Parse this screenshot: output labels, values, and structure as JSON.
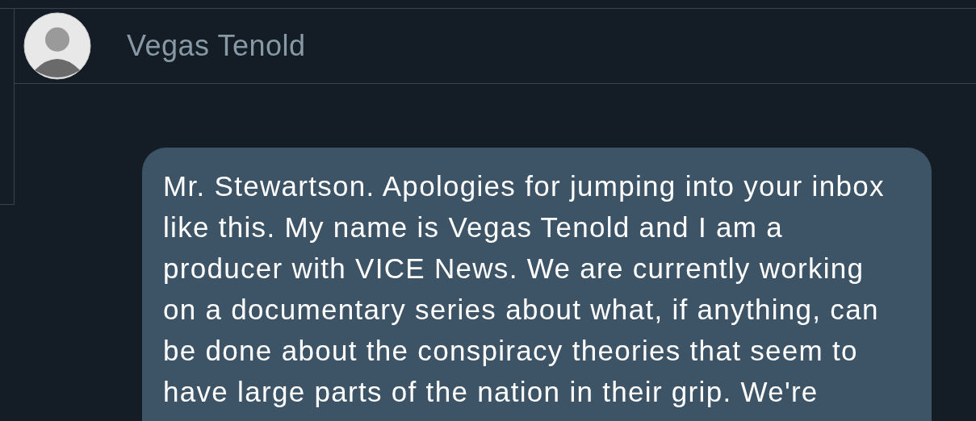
{
  "conversation": {
    "contact_name": "Vegas Tenold"
  },
  "messages": [
    {
      "lines": [
        "Mr. Stewartson. Apologies for jumping into your inbox",
        "like this. My name is Vegas Tenold and I am a",
        "producer with VICE News. We are currently working",
        "on a documentary series about what, if anything, can",
        "be done about the conspiracy theories that seem to",
        "have large parts of the nation in their grip. We're"
      ]
    }
  ]
}
